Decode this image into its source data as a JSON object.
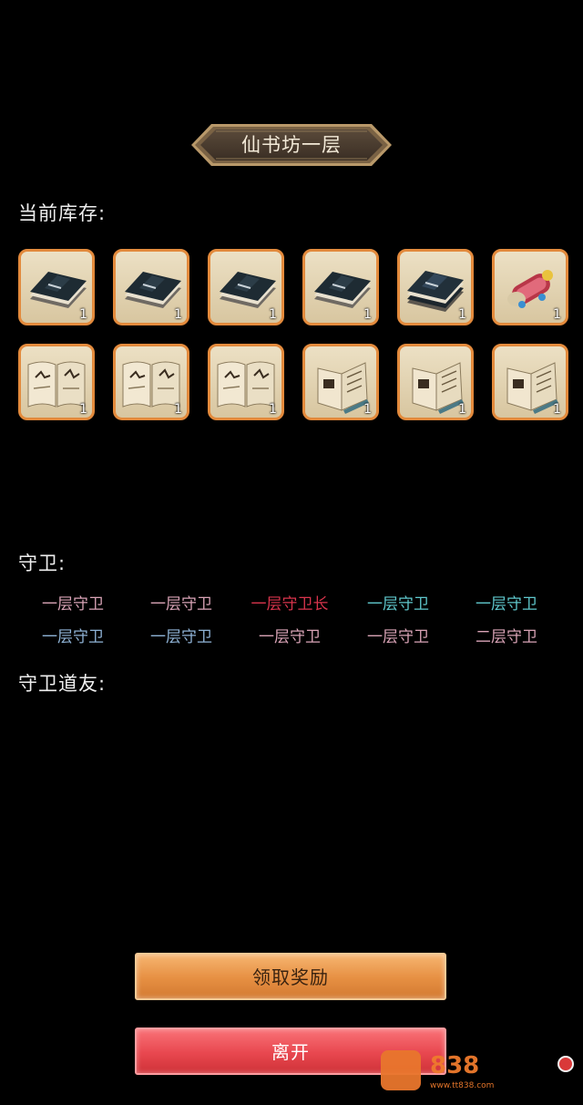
{
  "title": "仙书坊一层",
  "inventory": {
    "label": "当前库存:",
    "items": [
      {
        "icon": "dark-book-icon",
        "qty": "1"
      },
      {
        "icon": "dark-book-icon",
        "qty": "1"
      },
      {
        "icon": "dark-book-icon",
        "qty": "1"
      },
      {
        "icon": "dark-book-icon",
        "qty": "1"
      },
      {
        "icon": "dark-book-stack-icon",
        "qty": "1"
      },
      {
        "icon": "scroll-icon",
        "qty": "1"
      },
      {
        "icon": "open-book-icon",
        "qty": "1"
      },
      {
        "icon": "open-book-icon",
        "qty": "1"
      },
      {
        "icon": "open-book-icon",
        "qty": "1"
      },
      {
        "icon": "open-manual-icon",
        "qty": "1"
      },
      {
        "icon": "open-manual-icon",
        "qty": "1"
      },
      {
        "icon": "open-manual-icon",
        "qty": "1"
      }
    ]
  },
  "guards": {
    "label": "守卫:",
    "list": [
      {
        "name": "一层守卫",
        "color": "#d9a3b6"
      },
      {
        "name": "一层守卫",
        "color": "#d9a3b6"
      },
      {
        "name": "一层守卫长",
        "color": "#d8344c"
      },
      {
        "name": "一层守卫",
        "color": "#5fc7cc"
      },
      {
        "name": "一层守卫",
        "color": "#5fc7cc"
      },
      {
        "name": "一层守卫",
        "color": "#8fb3d6"
      },
      {
        "name": "一层守卫",
        "color": "#8fb3d6"
      },
      {
        "name": "一层守卫",
        "color": "#d9a3b6"
      },
      {
        "name": "一层守卫",
        "color": "#d9a3b6"
      },
      {
        "name": "二层守卫",
        "color": "#d9a3b6"
      }
    ]
  },
  "allies": {
    "label": "守卫道友:"
  },
  "buttons": {
    "claim": "领取奖励",
    "leave": "离开"
  },
  "watermark": {
    "text": "838",
    "sub": "www.tt838.com"
  },
  "colors": {
    "slot_border": "#e38a3c",
    "claim_button": "#e68f42",
    "leave_button": "#e8474f"
  }
}
